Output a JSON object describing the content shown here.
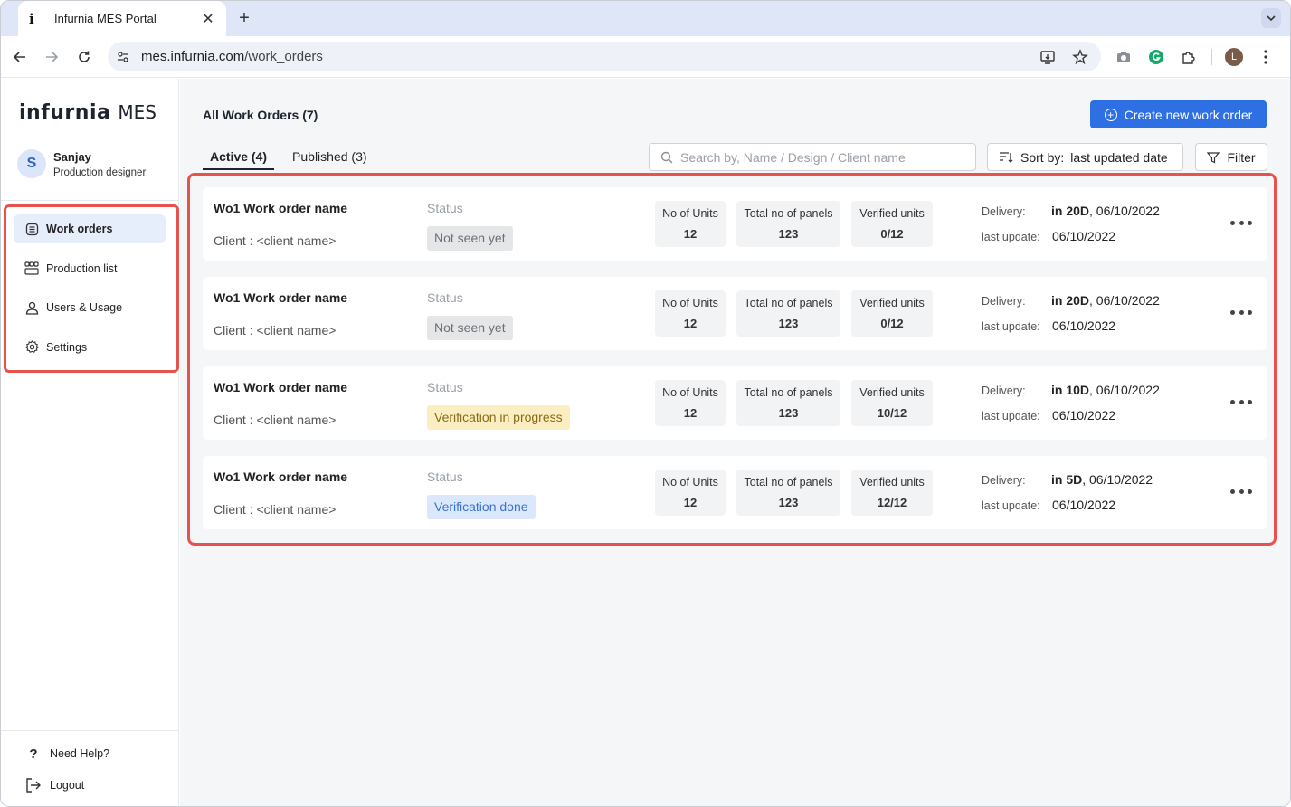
{
  "browser": {
    "tab_title": "Infurnia MES Portal",
    "tab_favicon": "i",
    "new_tab": "+",
    "url_host": "mes.infurnia.com",
    "url_path": "/work_orders",
    "profile_initial": "L"
  },
  "sidebar": {
    "logo_word": "infurnia",
    "logo_suffix": "MES",
    "user": {
      "initial": "S",
      "name": "Sanjay",
      "role": "Production designer"
    },
    "items": [
      {
        "label": "Work orders",
        "icon": "list-icon",
        "active": true
      },
      {
        "label": "Production list",
        "icon": "grid-icon",
        "active": false
      },
      {
        "label": "Users & Usage",
        "icon": "user-icon",
        "active": false
      },
      {
        "label": "Settings",
        "icon": "gear-icon",
        "active": false
      }
    ],
    "help_label": "Need Help?",
    "logout_label": "Logout"
  },
  "main": {
    "title": "All Work Orders (7)",
    "create_button": "Create new work order",
    "tabs": [
      {
        "label": "Active (4)",
        "active": true
      },
      {
        "label": "Published (3)",
        "active": false
      }
    ],
    "search_placeholder": "Search by, Name / Design / Client name",
    "sort_label": "Sort by:",
    "sort_value": "last updated date",
    "filter_label": "Filter",
    "labels": {
      "status": "Status",
      "units": "No of Units",
      "panels": "Total no of panels",
      "verified": "Verified units",
      "delivery": "Delivery:",
      "last_update": "last update:"
    },
    "orders": [
      {
        "name": "Wo1  Work order name",
        "client": "Client : <client name>",
        "status": "Not seen yet",
        "status_kind": "grey",
        "units": "12",
        "panels": "123",
        "verified": "0/12",
        "delivery_rel": "in 20D",
        "delivery_date": ", 06/10/2022",
        "last_update": "06/10/2022"
      },
      {
        "name": "Wo1  Work order name",
        "client": "Client : <client name>",
        "status": "Not seen yet",
        "status_kind": "grey",
        "units": "12",
        "panels": "123",
        "verified": "0/12",
        "delivery_rel": "in 20D",
        "delivery_date": ", 06/10/2022",
        "last_update": "06/10/2022"
      },
      {
        "name": "Wo1  Work order name",
        "client": "Client : <client name>",
        "status": "Verification in progress",
        "status_kind": "yellow",
        "units": "12",
        "panels": "123",
        "verified": "10/12",
        "delivery_rel": "in 10D",
        "delivery_date": ", 06/10/2022",
        "last_update": "06/10/2022"
      },
      {
        "name": "Wo1  Work order name",
        "client": "Client : <client name>",
        "status": "Verification done",
        "status_kind": "blue",
        "units": "12",
        "panels": "123",
        "verified": "12/12",
        "delivery_rel": "in 5D",
        "delivery_date": ", 06/10/2022",
        "last_update": "06/10/2022"
      }
    ]
  },
  "colors": {
    "accent": "#2f6fe4",
    "highlight": "#e8524e"
  }
}
